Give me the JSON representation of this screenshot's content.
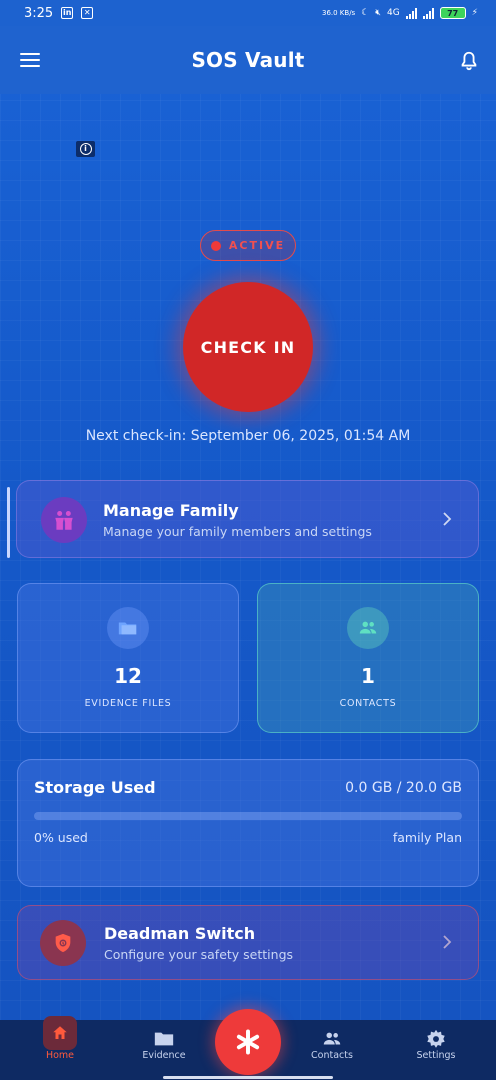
{
  "status_bar": {
    "time": "3:25",
    "speed": "36.0 KB/s",
    "network": "4G",
    "battery": "77"
  },
  "header": {
    "title": "SOS Vault"
  },
  "status": {
    "label": "ACTIVE",
    "color": "#f03a3a"
  },
  "checkin": {
    "button_label": "CHECK IN",
    "next_text": "Next check-in: September 06, 2025, 01:54 AM"
  },
  "family": {
    "title": "Manage Family",
    "subtitle": "Manage your family members and settings"
  },
  "stats": {
    "evidence": {
      "value": "12",
      "label": "EVIDENCE FILES"
    },
    "contacts": {
      "value": "1",
      "label": "CONTACTS"
    }
  },
  "storage": {
    "title": "Storage Used",
    "value_text": "0.0 GB / 20.0 GB",
    "percent_text": "0% used",
    "plan": "family Plan",
    "fraction": 0
  },
  "deadman": {
    "title": "Deadman Switch",
    "subtitle": "Configure your safety settings"
  },
  "bottom_nav": {
    "home": "Home",
    "evidence": "Evidence",
    "contacts": "Contacts",
    "settings": "Settings"
  },
  "colors": {
    "accent_red": "#d12727",
    "nav_active": "#ff5a3c",
    "background": "#1656c4"
  }
}
